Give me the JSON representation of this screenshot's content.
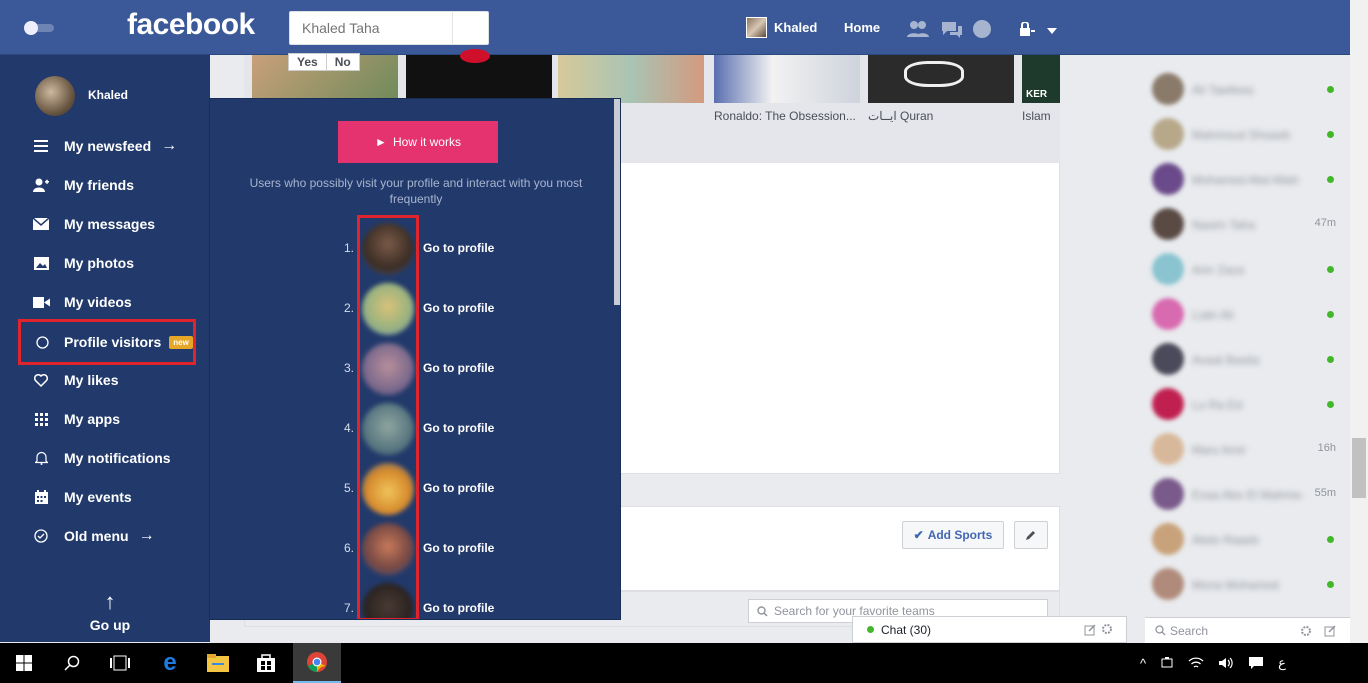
{
  "topbar": {
    "logo": "facebook",
    "search_placeholder": "Khaled Taha",
    "user_name": "Khaled",
    "home_label": "Home"
  },
  "sidebar": {
    "user_name": "Khaled",
    "items": [
      {
        "label": "My newsfeed",
        "icon": "newsfeed-icon",
        "arrow": "→"
      },
      {
        "label": "My friends",
        "icon": "friends-icon"
      },
      {
        "label": "My messages",
        "icon": "messages-icon"
      },
      {
        "label": "My photos",
        "icon": "photos-icon"
      },
      {
        "label": "My videos",
        "icon": "videos-icon"
      },
      {
        "label": "Profile visitors",
        "icon": "circle-icon",
        "badge": "new"
      },
      {
        "label": "My likes",
        "icon": "heart-icon"
      },
      {
        "label": "My apps",
        "icon": "apps-grid-icon"
      },
      {
        "label": "My notifications",
        "icon": "bell-icon"
      },
      {
        "label": "My events",
        "icon": "calendar-icon"
      },
      {
        "label": "Old menu",
        "icon": "check-circle-icon",
        "arrow": "→"
      }
    ],
    "go_up_label": "Go up",
    "go_up_arrow": "↑"
  },
  "feed": {
    "poll_yes": "Yes",
    "poll_no": "No",
    "thumbnails": [
      {
        "label": "Ronaldo: The Obsession..."
      },
      {
        "label": "ايــات Quran"
      },
      {
        "label": "Islam"
      }
    ],
    "thumb_overlay_text": "KER",
    "add_sports_label": "Add Sports",
    "teams_search_placeholder": "Search for your favorite teams"
  },
  "panel": {
    "how_it_works": "How it works",
    "subtitle": "Users who possibly visit your profile and interact with you most frequently",
    "visitors": [
      {
        "num": "1.",
        "link": "Go to profile"
      },
      {
        "num": "2.",
        "link": "Go to profile"
      },
      {
        "num": "3.",
        "link": "Go to profile"
      },
      {
        "num": "4.",
        "link": "Go to profile"
      },
      {
        "num": "5.",
        "link": "Go to profile"
      },
      {
        "num": "6.",
        "link": "Go to profile"
      },
      {
        "num": "7.",
        "link": "Go to profile"
      }
    ]
  },
  "chat": {
    "contacts": [
      {
        "name": "Ali Tawfeeq",
        "status": "online"
      },
      {
        "name": "Mahmoud Shoaeb",
        "status": "online"
      },
      {
        "name": "Mohamed Abd Allah",
        "status": "online"
      },
      {
        "name": "Nasim Taha",
        "time": "47m"
      },
      {
        "name": "Amr Zaza",
        "status": "online"
      },
      {
        "name": "Lojin Ali",
        "status": "online"
      },
      {
        "name": "Ayaat Bastia",
        "status": "online"
      },
      {
        "name": "Lu Ra Ed",
        "status": "online"
      },
      {
        "name": "Mary Amir",
        "time": "16h"
      },
      {
        "name": "Esaa Abo El Mahmed",
        "time": "55m"
      },
      {
        "name": "Abdo Rageb",
        "status": "online"
      },
      {
        "name": "Mona Mohamed",
        "status": "online"
      }
    ],
    "bar_label": "Chat (30)",
    "search_placeholder": "Search"
  },
  "taskbar": {
    "lang": "ع"
  }
}
